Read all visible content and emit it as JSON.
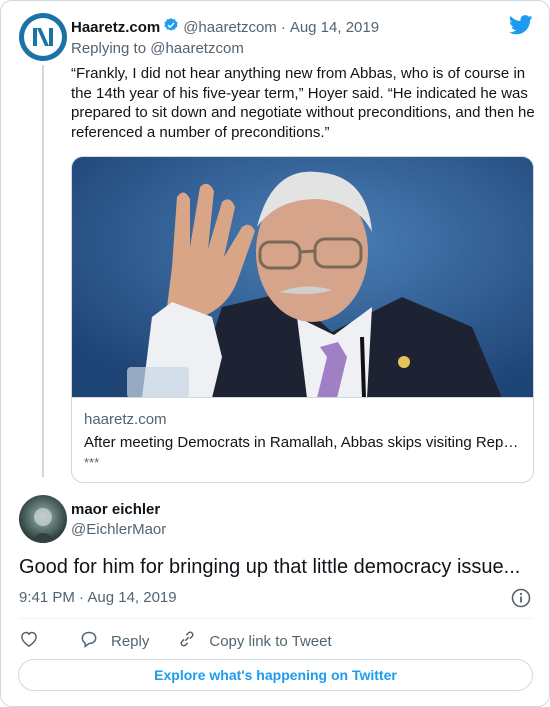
{
  "colors": {
    "accent": "#1d9bf0",
    "secondary_text": "#536471",
    "border": "#cfd9de"
  },
  "parent_tweet": {
    "avatar_icon": "haaretz-logo-icon",
    "name": "Haaretz.com",
    "verified_icon": "verified-badge-icon",
    "handle": "@haaretzcom",
    "separator": "·",
    "date": "Aug 14, 2019",
    "replying_to": "Replying to @haaretzcom",
    "text": "“Frankly, I did not hear anything new from Abbas, who is of course in the 14th year of his five-year term,” Hoyer said. “He indicated he was prepared to sit down and negotiate without preconditions, and then he referenced a number of preconditions.”",
    "link_card": {
      "image_icon": "news-photo",
      "domain": "haaretz.com",
      "title": "After meeting Democrats in Ramallah, Abbas skips visiting Rep…",
      "description": "***"
    }
  },
  "brand_icon": "twitter-bird-icon",
  "main_tweet": {
    "name": "maor eichler",
    "handle": "@EichlerMaor",
    "text": "Good for him for bringing up that little democracy issue...",
    "timestamp": "9:41 PM · Aug 14, 2019",
    "info_icon": "info-icon"
  },
  "actions": {
    "like_icon": "heart-icon",
    "reply_label": "Reply",
    "copy_label": "Copy link to Tweet"
  },
  "explore_label": "Explore what's happening on Twitter"
}
